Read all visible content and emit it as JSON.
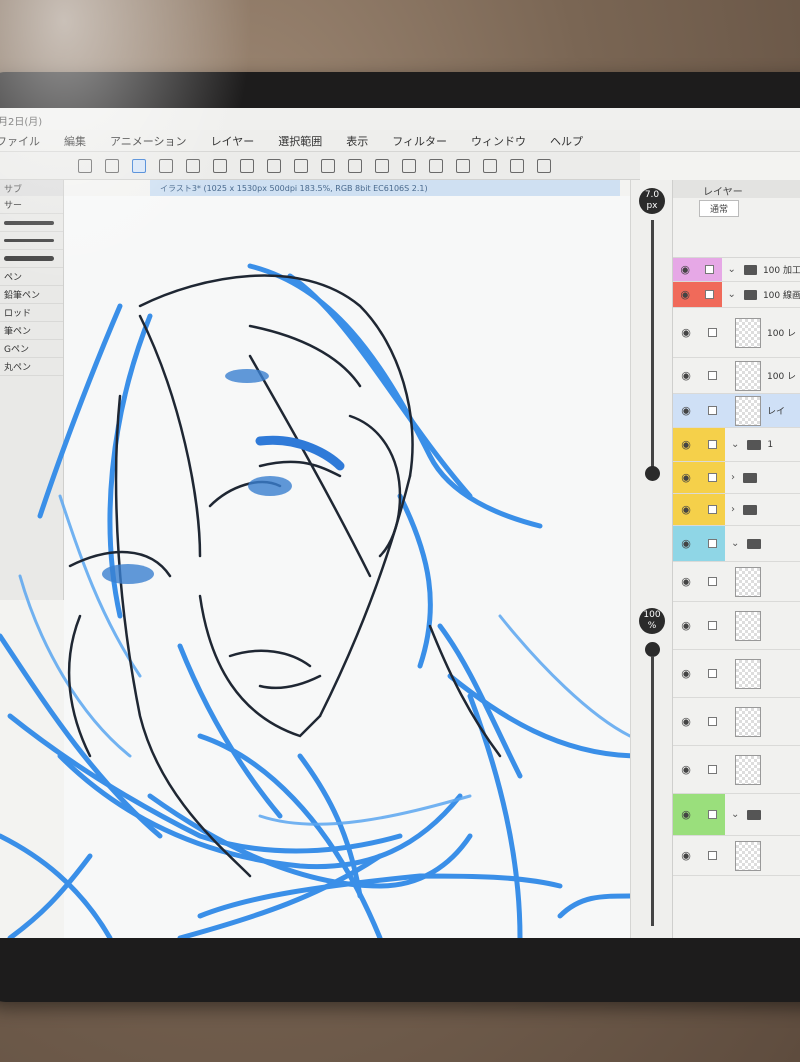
{
  "status": {
    "date": "月2日(月)"
  },
  "menu": [
    "ファイル",
    "編集",
    "アニメーション",
    "レイヤー",
    "選択範囲",
    "表示",
    "フィルター",
    "ウィンドウ",
    "ヘルプ"
  ],
  "document_tab": "イラスト3* (1025 x 1530px 500dpi 183.5%, RGB 8bit EC6106S 2.1)",
  "tool_palette": {
    "header": "サブ",
    "brushes": [
      "サー",
      "ペン",
      "鉛筆ペン",
      "ロッド",
      "筆ペン",
      "Gペン",
      "丸ペン"
    ]
  },
  "sliders": {
    "brush_size": "7.0",
    "brush_size_unit": "px",
    "opacity": "100",
    "opacity_unit": "%"
  },
  "layers": {
    "title": "レイヤー",
    "blend_mode": "通常",
    "rows": [
      {
        "name": "100 加工",
        "type": "folder",
        "color": "#e6a8e6"
      },
      {
        "name": "100 線画",
        "type": "folder",
        "color": "#f06a5a"
      },
      {
        "name": "100 レ",
        "type": "layer",
        "color": ""
      },
      {
        "name": "100 レ",
        "type": "layer",
        "color": ""
      },
      {
        "name": "レイ",
        "type": "layer-selected",
        "color": ""
      },
      {
        "name": "1",
        "type": "folder",
        "color": "#f5d04a"
      },
      {
        "name": "",
        "type": "folder-collapsed",
        "color": "#f5d04a"
      },
      {
        "name": "",
        "type": "folder-collapsed",
        "color": "#f5d04a"
      },
      {
        "name": "",
        "type": "folder",
        "color": "#8fd6e6"
      },
      {
        "name": "",
        "type": "layer",
        "color": ""
      },
      {
        "name": "",
        "type": "layer",
        "color": ""
      },
      {
        "name": "",
        "type": "layer",
        "color": ""
      },
      {
        "name": "",
        "type": "layer",
        "color": ""
      },
      {
        "name": "",
        "type": "layer",
        "color": ""
      },
      {
        "name": "",
        "type": "folder",
        "color": "#9adf7c"
      },
      {
        "name": "",
        "type": "layer",
        "color": ""
      }
    ]
  },
  "colors": {
    "accent": "#3d7fd4",
    "sketch_blue": "#3a8fe8",
    "lineart": "#1f2733"
  }
}
